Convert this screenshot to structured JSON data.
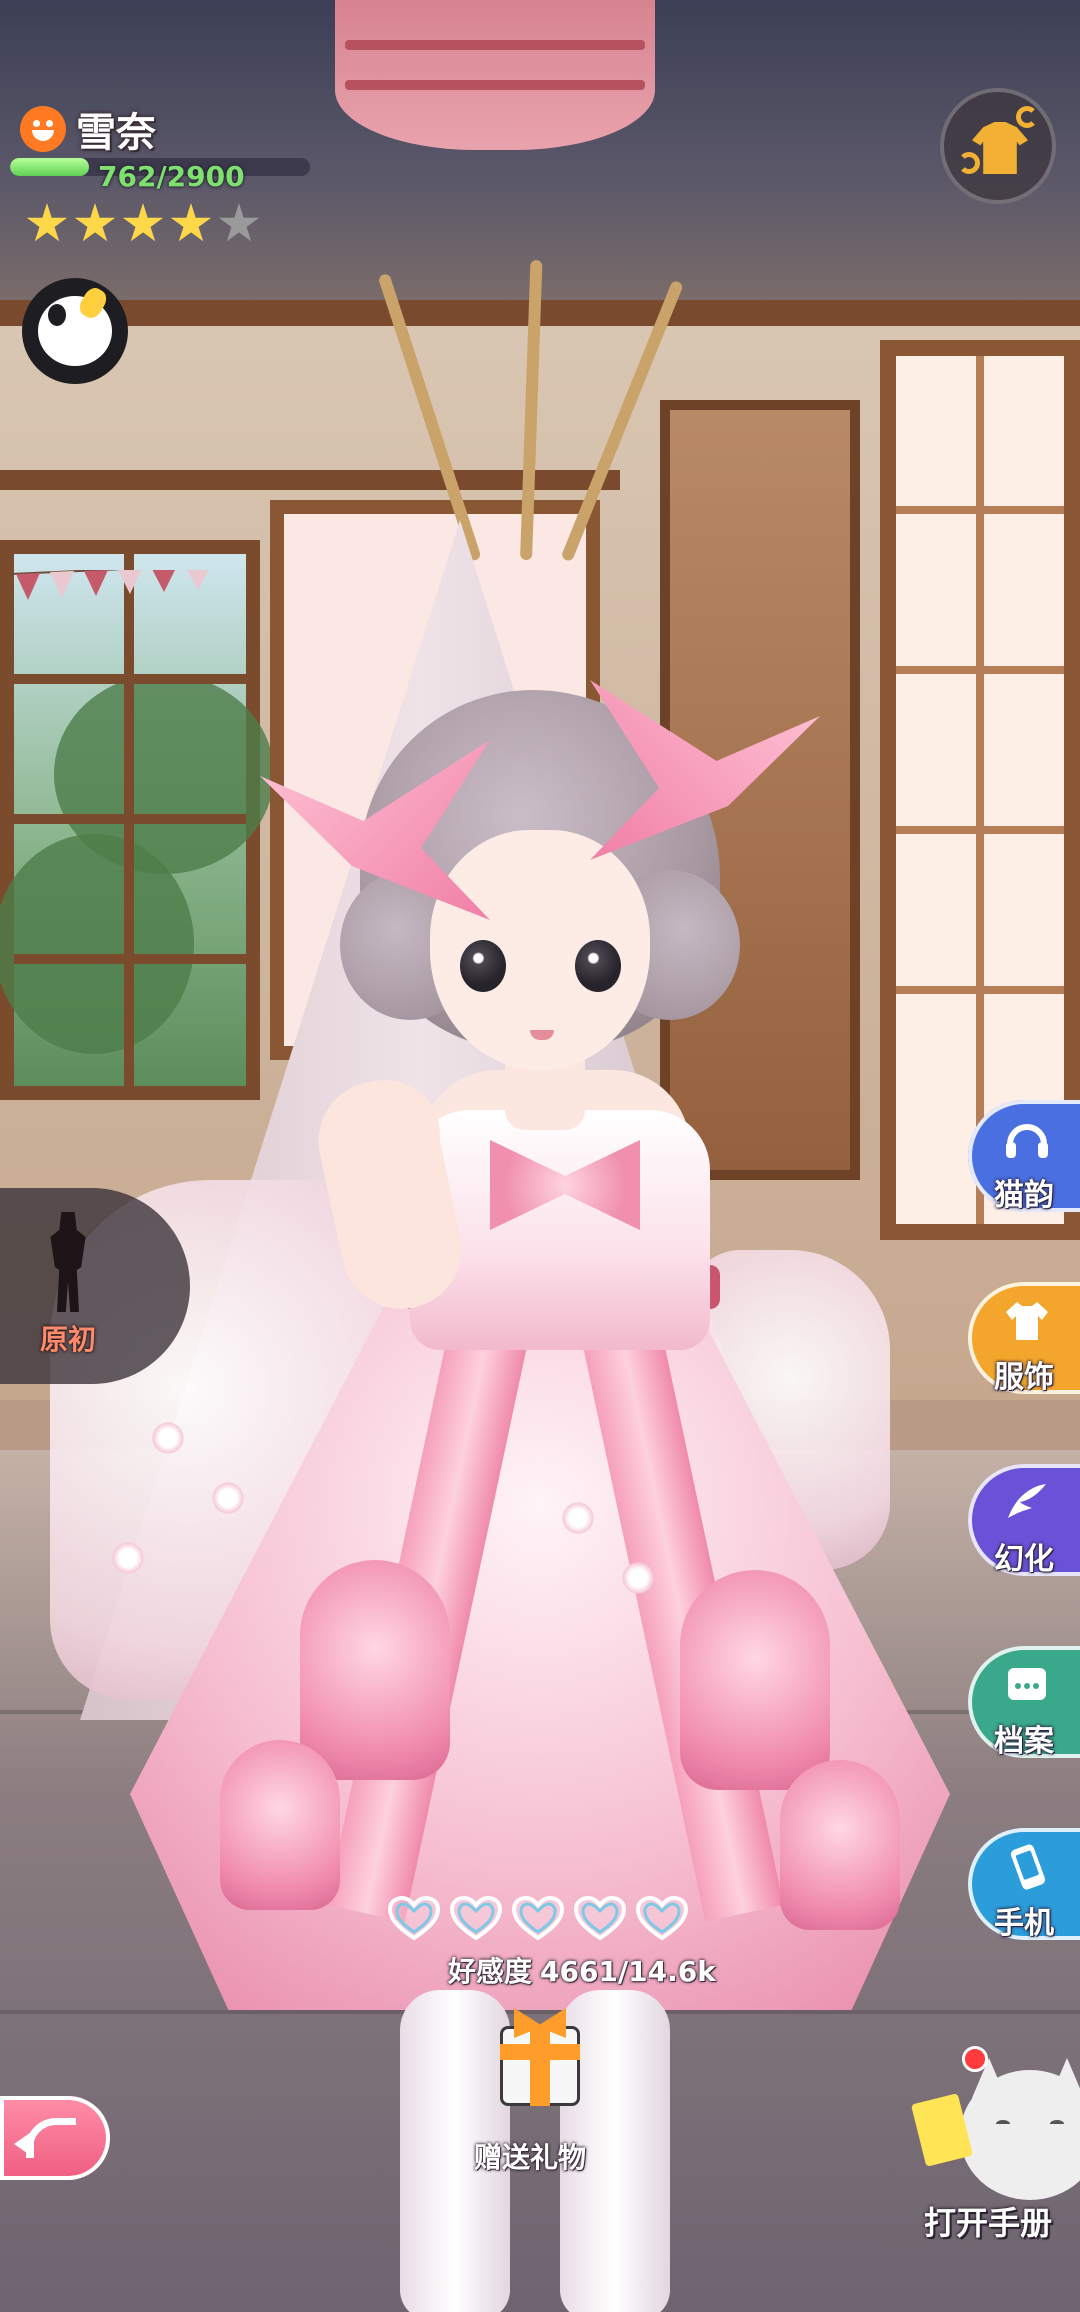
{
  "character": {
    "name": "雪奈",
    "xp_text": "762/2900",
    "xp_fraction": 0.263,
    "stars_filled": 4,
    "stars_total": 5
  },
  "side_menu": [
    {
      "label": "猫韵",
      "icon": "headphones-icon",
      "color": "#4a6fe0"
    },
    {
      "label": "服饰",
      "icon": "clothing-icon",
      "color": "#f3a52c"
    },
    {
      "label": "幻化",
      "icon": "wing-icon",
      "color": "#6a52d8"
    },
    {
      "label": "档案",
      "icon": "archive-icon",
      "color": "#3aa88a"
    },
    {
      "label": "手机",
      "icon": "phone-icon",
      "color": "#2c9ddb"
    }
  ],
  "origin_tab": {
    "label": "原初",
    "icon": "silhouette-icon"
  },
  "affinity": {
    "label": "好感度",
    "value": "4661/14.6k",
    "hearts_total": 5
  },
  "gift": {
    "label": "赠送礼物",
    "icon": "gift-icon"
  },
  "handbook": {
    "label": "打开手册",
    "icon": "cat-mascot-icon"
  },
  "icons": {
    "mood": "smile-face-icon",
    "mascot": "penguin-mascot-icon",
    "outfit_swap": "outfit-swap-icon",
    "back": "back-arrow-icon"
  },
  "colors": {
    "xp_bar": "#61d155",
    "xp_text": "#7fe06d",
    "star_on": "#ffd84a",
    "star_off": "#9a9a9a",
    "accent_pink": "#ef5d81"
  }
}
